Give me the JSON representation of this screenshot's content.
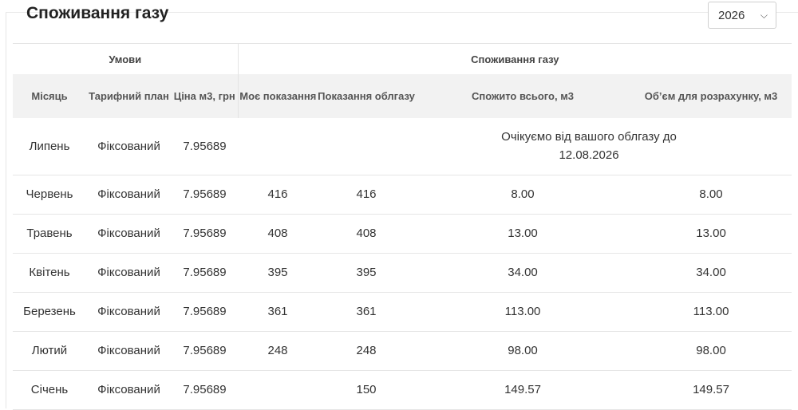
{
  "page": {
    "title": "Споживання газу"
  },
  "year_select": {
    "value": "2026"
  },
  "table": {
    "groups": {
      "conditions": "Умови",
      "consumption": "Споживання газу"
    },
    "columns": {
      "month": "Місяць",
      "tariff": "Тарифний план",
      "price": "Ціна м3, грн",
      "my_reading": "Моє показання",
      "meter_reading": "Показання облгазу",
      "total": "Спожито всього, м3",
      "volume": "Об’єм для розрахунку, м3"
    },
    "first_row": {
      "month": "Липень",
      "tariff": "Фіксований",
      "price": "7.95689",
      "pending_text": "Очікуємо від вашого облгазу до 12.08.2026"
    },
    "rows": [
      {
        "month": "Червень",
        "tariff": "Фіксований",
        "price": "7.95689",
        "my_reading": "416",
        "meter_reading": "416",
        "total": "8.00",
        "volume": "8.00"
      },
      {
        "month": "Травень",
        "tariff": "Фіксований",
        "price": "7.95689",
        "my_reading": "408",
        "meter_reading": "408",
        "total": "13.00",
        "volume": "13.00"
      },
      {
        "month": "Квітень",
        "tariff": "Фіксований",
        "price": "7.95689",
        "my_reading": "395",
        "meter_reading": "395",
        "total": "34.00",
        "volume": "34.00"
      },
      {
        "month": "Березень",
        "tariff": "Фіксований",
        "price": "7.95689",
        "my_reading": "361",
        "meter_reading": "361",
        "total": "113.00",
        "volume": "113.00"
      },
      {
        "month": "Лютий",
        "tariff": "Фіксований",
        "price": "7.95689",
        "my_reading": "248",
        "meter_reading": "248",
        "total": "98.00",
        "volume": "98.00"
      },
      {
        "month": "Січень",
        "tariff": "Фіксований",
        "price": "7.95689",
        "my_reading": "",
        "meter_reading": "150",
        "total": "149.57",
        "volume": "149.57"
      }
    ]
  }
}
